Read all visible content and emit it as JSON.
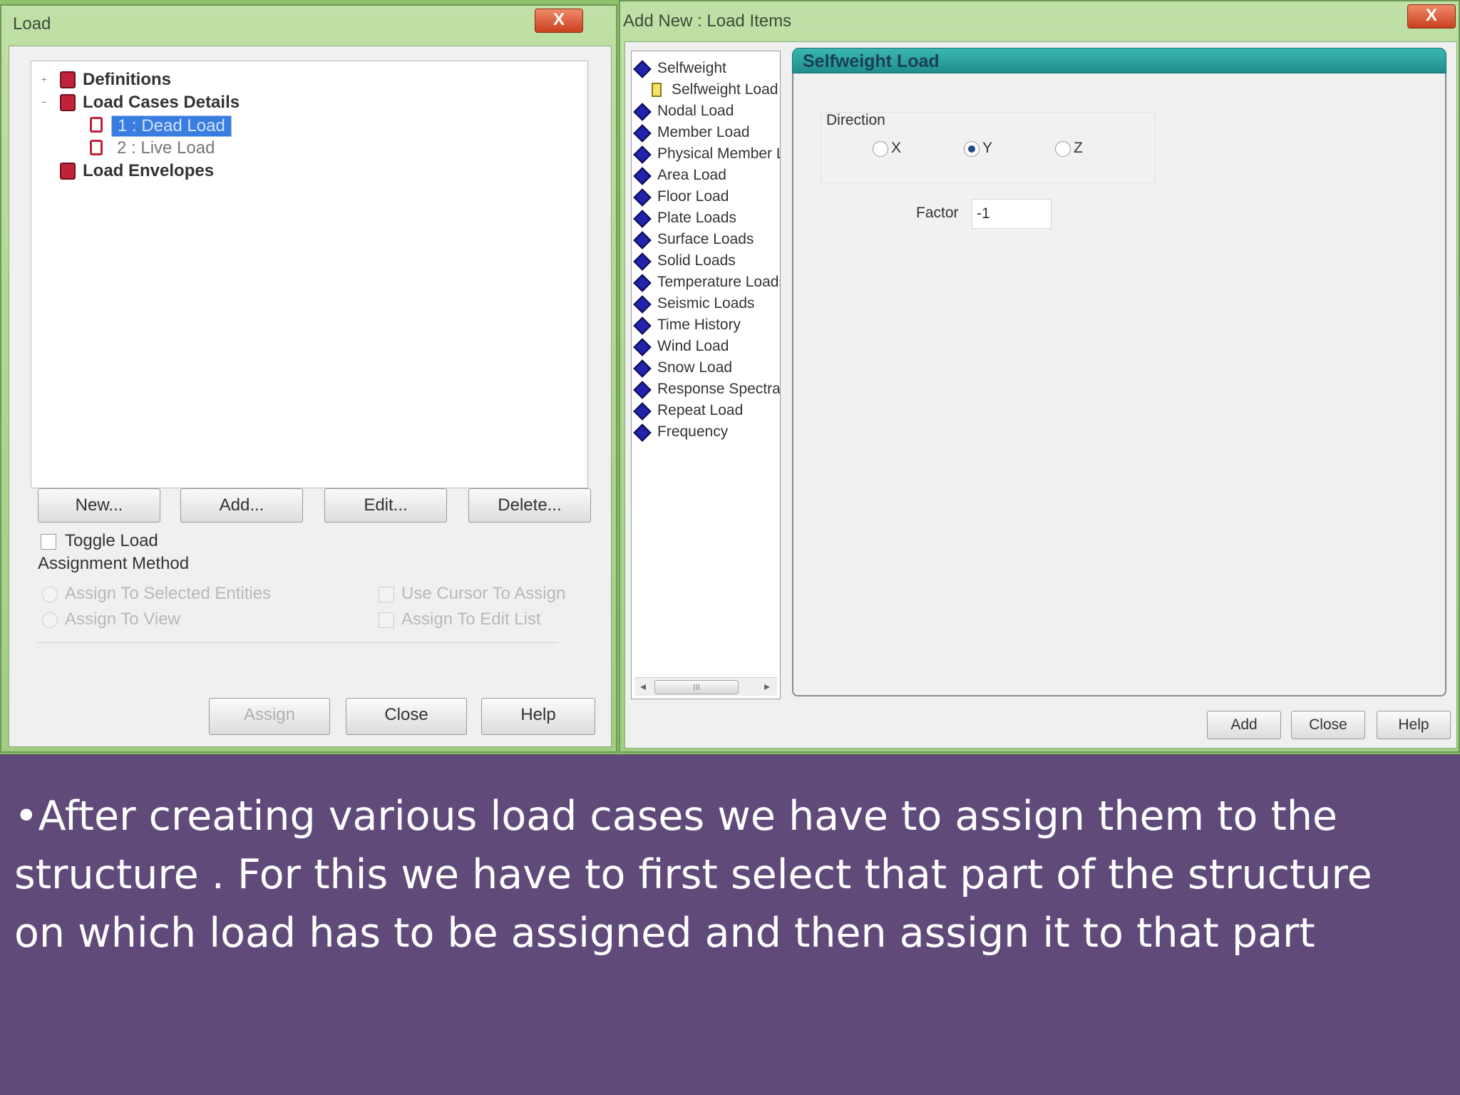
{
  "load_window": {
    "title": "Load",
    "close_glyph": "X",
    "tree": {
      "definitions": "Definitions",
      "load_cases_details": "Load Cases Details",
      "case_1": "1 : Dead Load",
      "case_2": "2 : Live Load",
      "load_envelopes": "Load Envelopes"
    },
    "buttons": {
      "new": "New...",
      "add": "Add...",
      "edit": "Edit...",
      "delete": "Delete..."
    },
    "toggle_label": "Toggle Load",
    "assignment_method_label": "Assignment Method",
    "options": {
      "assign_selected": "Assign To Selected Entities",
      "assign_view": "Assign To View",
      "use_cursor": "Use Cursor To Assign",
      "assign_edit_list": "Assign To Edit List"
    },
    "bottom_buttons": {
      "assign": "Assign",
      "close": "Close",
      "help": "Help"
    }
  },
  "add_window": {
    "title": "Add New : Load Items",
    "close_glyph": "X",
    "items": [
      "Selfweight",
      "Selfweight Load",
      "Nodal Load",
      "Member Load",
      "Physical Member Lo",
      "Area Load",
      "Floor Load",
      "Plate Loads",
      "Surface Loads",
      "Solid Loads",
      "Temperature Loads",
      "Seismic Loads",
      "Time History",
      "Wind Load",
      "Snow Load",
      "Response Spectra",
      "Repeat Load",
      "Frequency"
    ],
    "scroll": {
      "left": "◂",
      "right": "▸",
      "thumb": "III"
    },
    "panel_title": "Selfweight Load",
    "direction_label": "Direction",
    "directions": [
      "X",
      "Y",
      "Z"
    ],
    "selected_direction": "Y",
    "factor_label": "Factor",
    "factor_value": "-1",
    "buttons": {
      "add": "Add",
      "close": "Close",
      "help": "Help"
    }
  },
  "caption": "•After creating various load cases we have to assign them to the structure . For this we have to first select that part of the structure on which load has to be assigned and then assign it to that part",
  "colors": {
    "background": "#5f4a7a",
    "panel_header": "#2aa3a0",
    "window_frame": "#a8d48c"
  }
}
